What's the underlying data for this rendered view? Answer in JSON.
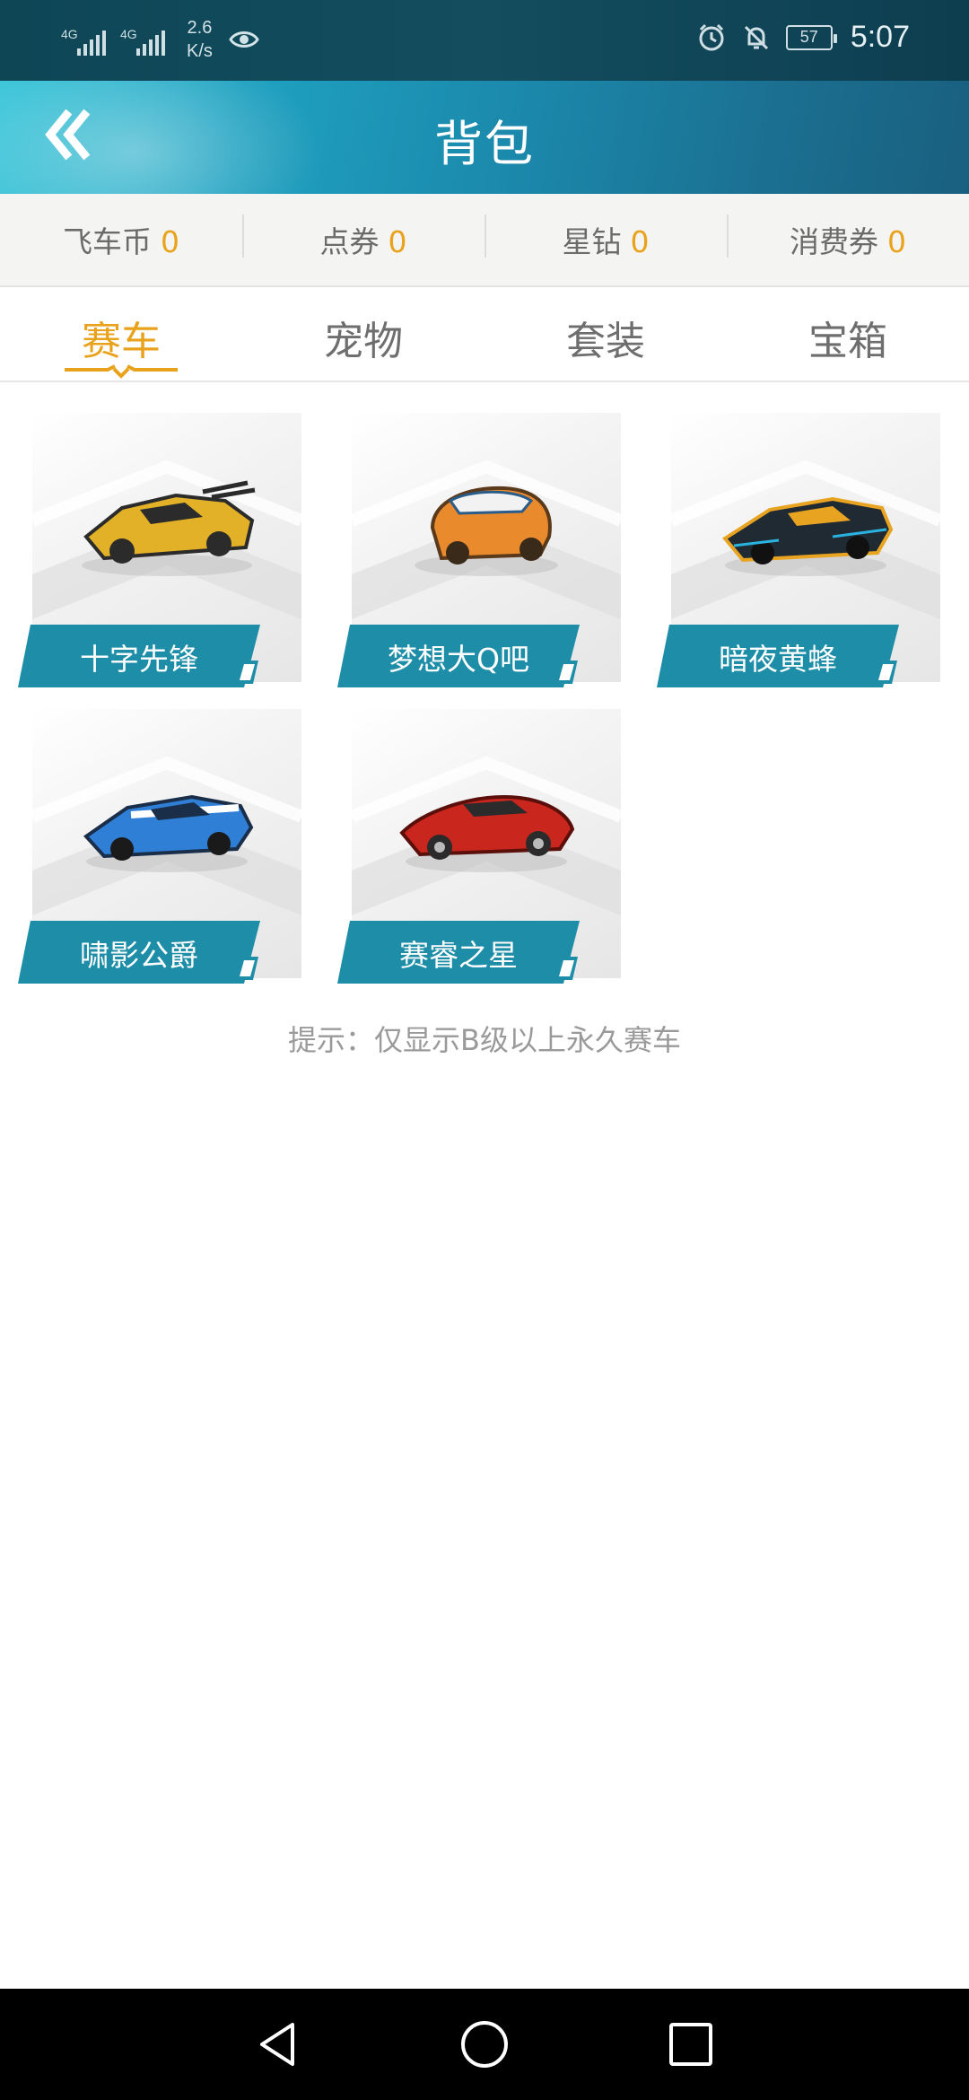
{
  "status_bar": {
    "network_1": "4G",
    "network_2": "4G",
    "speed_value": "2.6",
    "speed_unit": "K/s",
    "battery": "57",
    "time": "5:07"
  },
  "header": {
    "title": "背包",
    "back_icon": "double-chevron-left-icon"
  },
  "currencies": [
    {
      "label": "飞车币",
      "value": "0"
    },
    {
      "label": "点券",
      "value": "0"
    },
    {
      "label": "星钻",
      "value": "0"
    },
    {
      "label": "消费券",
      "value": "0"
    }
  ],
  "tabs": [
    {
      "label": "赛车",
      "active": true
    },
    {
      "label": "宠物",
      "active": false
    },
    {
      "label": "套装",
      "active": false
    },
    {
      "label": "宝箱",
      "active": false
    }
  ],
  "cars": [
    {
      "name": "十字先锋",
      "colors": [
        "#e2b127",
        "#2b2b2b"
      ]
    },
    {
      "name": "梦想大Q吧",
      "colors": [
        "#e98a2c",
        "#f2f2f2"
      ]
    },
    {
      "name": "暗夜黄蜂",
      "colors": [
        "#1f2a33",
        "#e8a321"
      ]
    },
    {
      "name": "啸影公爵",
      "colors": [
        "#2f7fd6",
        "#ffffff"
      ]
    },
    {
      "name": "赛睿之星",
      "colors": [
        "#c9261d",
        "#2b2b2b"
      ]
    }
  ],
  "hint": "提示：仅显示B级以上永久赛车",
  "colors": {
    "accent": "#e9a21b",
    "label_teal": "#1e8ea8",
    "header_gradient_start": "#3cc6d9",
    "header_gradient_end": "#1a5f7f"
  }
}
